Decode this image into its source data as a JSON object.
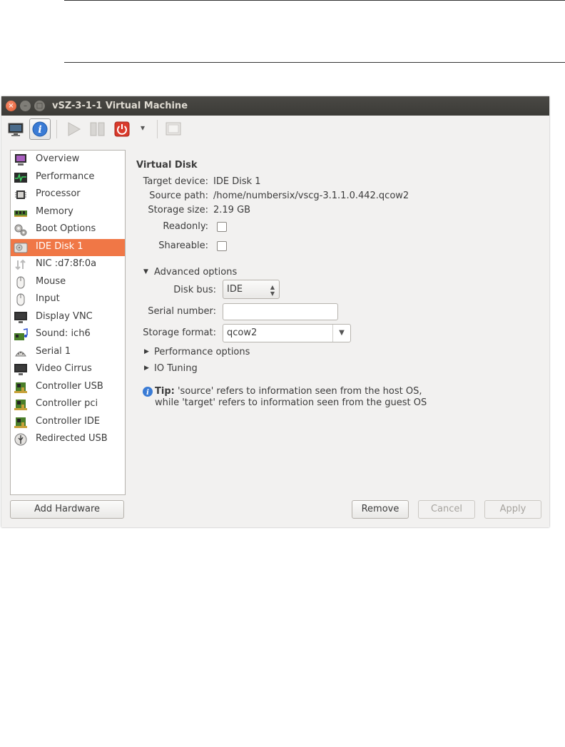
{
  "window": {
    "title": "vSZ-3-1-1 Virtual Machine",
    "controls": {
      "close": "×",
      "minimize": "–",
      "maximize": "□"
    }
  },
  "toolbar": {
    "buttons": [
      "console-icon",
      "info-icon",
      "run-icon",
      "pause-icon",
      "power-icon",
      "dropdown-arrow-icon",
      "fullscreen-icon"
    ],
    "dropdown": "▾"
  },
  "sidebar": {
    "items": [
      {
        "label": "Overview",
        "icon": "overview-icon"
      },
      {
        "label": "Performance",
        "icon": "performance-icon"
      },
      {
        "label": "Processor",
        "icon": "processor-icon"
      },
      {
        "label": "Memory",
        "icon": "memory-icon"
      },
      {
        "label": "Boot Options",
        "icon": "boot-options-icon"
      },
      {
        "label": "IDE Disk 1",
        "icon": "disk-icon"
      },
      {
        "label": "NIC :d7:8f:0a",
        "icon": "nic-icon"
      },
      {
        "label": "Mouse",
        "icon": "mouse-icon"
      },
      {
        "label": "Input",
        "icon": "input-icon"
      },
      {
        "label": "Display VNC",
        "icon": "display-icon"
      },
      {
        "label": "Sound: ich6",
        "icon": "sound-icon"
      },
      {
        "label": "Serial 1",
        "icon": "serial-icon"
      },
      {
        "label": "Video Cirrus",
        "icon": "video-icon"
      },
      {
        "label": "Controller USB",
        "icon": "controller-icon"
      },
      {
        "label": "Controller pci",
        "icon": "controller-icon"
      },
      {
        "label": "Controller IDE",
        "icon": "controller-icon"
      },
      {
        "label": "Redirected USB",
        "icon": "usb-icon"
      }
    ],
    "selected": "IDE Disk 1",
    "accent": "#f07746"
  },
  "details": {
    "heading": "Virtual Disk",
    "target_device_label": "Target device:",
    "target_device_value": "IDE Disk 1",
    "source_path_label": "Source path:",
    "source_path_value": "/home/numbersix/vscg-3.1.1.0.442.qcow2",
    "storage_size_label": "Storage size:",
    "storage_size_value": "2.19 GB",
    "readonly_label": "Readonly:",
    "shareable_label": "Shareable:",
    "advanced_label": "Advanced options",
    "disk_bus_label": "Disk bus:",
    "disk_bus_value": "IDE",
    "serial_label": "Serial number:",
    "serial_value": "",
    "storage_format_label": "Storage format:",
    "storage_format_value": "qcow2",
    "performance_label": "Performance options",
    "io_label": "IO Tuning",
    "tip_bold": "Tip:",
    "tip_line1": "'source' refers to information seen from the host OS,",
    "tip_line2": "while 'target' refers to information seen from the guest OS"
  },
  "buttons": {
    "add_hardware": "Add Hardware",
    "remove": "Remove",
    "cancel": "Cancel",
    "apply": "Apply"
  }
}
